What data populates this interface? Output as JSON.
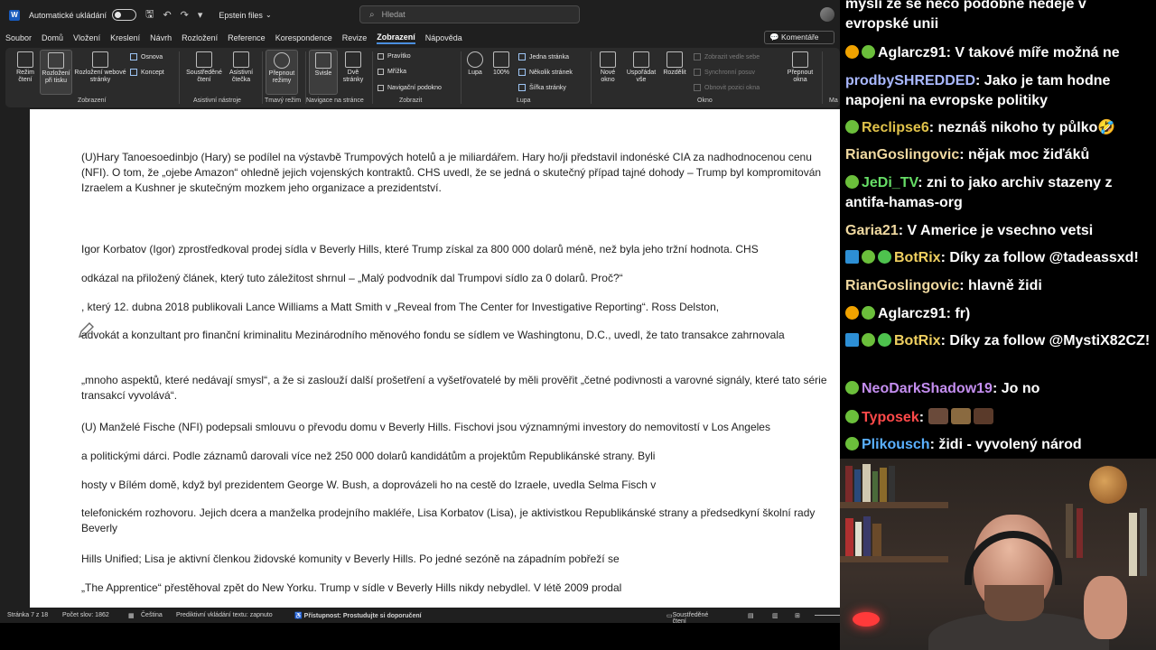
{
  "word": {
    "autosave_label": "Automatické ukládání",
    "filename": "Epstein files",
    "search_placeholder": "Hledat",
    "menu": [
      "Soubor",
      "Domů",
      "Vložení",
      "Kreslení",
      "Návrh",
      "Rozložení",
      "Reference",
      "Korespondence",
      "Revize",
      "Zobrazení",
      "Nápověda"
    ],
    "active_menu": "Zobrazení",
    "comments_label": "Komentáře",
    "ribbon": {
      "read_mode": "Režim čtení",
      "print_layout": "Rozložení při tisku",
      "web_layout": "Rozložení webové stránky",
      "outline": "Osnova",
      "draft": "Koncept",
      "group_views": "Zobrazení",
      "immersive_reader": "Soustředěné čtení",
      "read_aloud": "Asistivní čtečka",
      "group_accessibility": "Asistivní nástroje",
      "switch_modes": "Přepnout režimy",
      "group_dark": "Tmavý režim",
      "vertical": "Svisle",
      "side_to_side": "Dvě stránky",
      "group_nav": "Navigace na stránce",
      "ruler": "Pravítko",
      "gridlines": "Mřížka",
      "nav_pane": "Navigační podokno",
      "group_show": "Zobrazit",
      "zoom": "Lupa",
      "zoom_100": "100%",
      "one_page": "Jedna stránka",
      "multiple_pages": "Několik stránek",
      "page_width": "Šířka stránky",
      "group_zoom": "Lupa",
      "new_window": "Nové okno",
      "arrange_all": "Uspořádat vše",
      "split": "Rozdělit",
      "view_side": "Zobrazit vedle sebe",
      "sync_scroll": "Synchronní posuv",
      "reset_pos": "Obnovit pozici okna",
      "group_window": "Okno",
      "switch_windows": "Přepnout okna",
      "macros_short": "Ma"
    },
    "paragraphs": [
      "(U)Hary Tanoesoedinbjo (Hary) se podílel na výstavbě Trumpových hotelů a je miliardářem. Hary ho/ji představil indonéské CIA za nadhodnocenou cenu (NFI). O tom, že „ojebe Amazon“ ohledně jejich vojenských kontraktů. CHS uvedl, že se jedná o skutečný případ tajné dohody – Trump byl kompromitován Izraelem a Kushner je skutečným mozkem jeho organizace a prezidentství.",
      "Igor Korbatov (Igor) zprostředkoval prodej sídla v Beverly Hills, které Trump získal za 800 000 dolarů méně, než byla jeho tržní hodnota. CHS",
      "odkázal na přiložený článek, který tuto záležitost shrnul – „Malý podvodník dal Trumpovi sídlo za 0 dolarů. Proč?“",
      ", který 12. dubna 2018 publikovali Lance Williams a Matt Smith v „Reveal from The Center for Investigative Reporting“. Ross Delston,",
      "advokát a konzultant pro finanční kriminalitu Mezinárodního měnového fondu se sídlem ve Washingtonu, D.C., uvedl, že tato transakce zahrnovala",
      "„mnoho aspektů, které nedávají smysl“, a že si zaslouží další prošetření a vyšetřovatelé by měli prověřit „četné podivnosti a varovné signály, které tato série transakcí vyvolává“.",
      "(U) Manželé Fische (NFI) podepsali smlouvu o převodu domu v Beverly Hills. Fischovi jsou významnými investory do nemovitostí v Los Angeles",
      "a politickými dárci. Podle záznamů darovali více než 250 000 dolarů kandidátům a projektům Republikánské strany. Byli",
      "hosty v Bílém domě, když byl prezidentem George W. Bush, a doprovázeli ho na cestě do Izraele, uvedla Selma Fisch v",
      "telefonickém rozhovoru. Jejich dcera a manželka prodejního makléře, Lisa Korbatov (Lisa), je aktivistkou Republikánské strany a předsedkyní školní rady Beverly",
      "Hills Unified; Lisa je aktivní členkou židovské komunity v Beverly Hills. Po jedné sezóně na západním pobřeží se",
      "„The Apprentice“ přestěhoval zpět do New Yorku. Trump v sídle v Beverly Hills nikdy nebydlel. V létě 2009 prodal"
    ],
    "status": {
      "page": "Stránka 7 z 18",
      "words": "Počet slov: 1862",
      "language": "Čeština",
      "predictions": "Prediktivní vkládání textu: zapnuto",
      "accessibility": "Přístupnost: Prostudujte si doporučení",
      "focus": "Soustředěné čtení"
    }
  },
  "chat": [
    {
      "user": "",
      "text": "myslí že se něco podobné nedeje v evropské unii",
      "color": "#ffffff",
      "badges": []
    },
    {
      "user": "Aglarcz91",
      "text": "V takové míře možná ne",
      "color": "#ffffff",
      "badges": [
        "yellow",
        "green"
      ]
    },
    {
      "user": "prodbySHREDDED",
      "text": "Jako je tam hodne napojeni na evropske politiky",
      "color": "#a9b8ff",
      "badges": []
    },
    {
      "user": "Reclipse6",
      "text": "neznáš nikoho ty půlko🤣",
      "color": "#e0c24a",
      "badges": [
        "green"
      ]
    },
    {
      "user": "RianGoslingovic",
      "text": "nějak moc žiďáků",
      "color": "#f0d9a0",
      "badges": []
    },
    {
      "user": "JeDi_TV",
      "text": "zni to jako archiv stazeny z antifa-hamas-org",
      "color": "#66dd66",
      "badges": [
        "green"
      ]
    },
    {
      "user": "Garia21",
      "text": "V Americe je vsechno vetsi",
      "color": "#f0d9a0",
      "badges": []
    },
    {
      "user": "BotRix",
      "text": "Díky za follow @tadeassxd!",
      "color": "#f0d060",
      "badges": [
        "blue",
        "green",
        "check"
      ]
    },
    {
      "user": "RianGoslingovic",
      "text": "hlavně židi",
      "color": "#f0d9a0",
      "badges": []
    },
    {
      "user": "Aglarcz91",
      "text": "fr)",
      "color": "#ffffff",
      "badges": [
        "yellow",
        "green"
      ]
    },
    {
      "user": "BotRix",
      "text": "Díky za follow @MystiX82CZ!",
      "color": "#f0d060",
      "badges": [
        "blue",
        "green",
        "check"
      ]
    },
    {
      "user": "NeoDarkShadow19",
      "text": "Jo no",
      "color": "#c48ef0",
      "badges": [
        "green"
      ]
    },
    {
      "user": "Typosek",
      "text": "",
      "color": "#ff4a4a",
      "badges": [
        "green"
      ],
      "emotes": 3
    },
    {
      "user": "Plikousch",
      "text": "židi - vyvolený národ",
      "color": "#5ab0ff",
      "badges": [
        "green"
      ]
    }
  ]
}
